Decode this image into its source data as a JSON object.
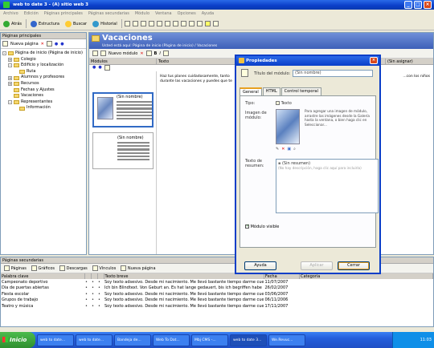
{
  "window": {
    "title": "web to date 3 - (A) sitio web 3"
  },
  "menu": [
    "Archivo",
    "Edición",
    "Páginas principales",
    "Páginas secundarias",
    "Módulo",
    "Ventana",
    "Opciones",
    "Ayuda"
  ],
  "toolbar": {
    "back": "Atrás",
    "structure": "Estructura",
    "search": "Buscar",
    "history": "Historial"
  },
  "left_panel": {
    "header": "Páginas principales",
    "new_page": "Nueva página",
    "tree": [
      {
        "label": "Página de inicio (Página de inicio)",
        "level": 0,
        "expander": "-"
      },
      {
        "label": "Colegio",
        "level": 1,
        "expander": "+"
      },
      {
        "label": "Edificio y localización",
        "level": 1,
        "expander": "-"
      },
      {
        "label": "Ruta",
        "level": 2,
        "expander": ""
      },
      {
        "label": "Alumnos y profesores",
        "level": 1,
        "expander": "+"
      },
      {
        "label": "Recursos",
        "level": 1,
        "expander": "+"
      },
      {
        "label": "Fechas y Ajustes",
        "level": 1,
        "expander": ""
      },
      {
        "label": "Vacaciones",
        "level": 1,
        "expander": ""
      },
      {
        "label": "Representantes",
        "level": 1,
        "expander": "-"
      },
      {
        "label": "Información",
        "level": 2,
        "expander": ""
      }
    ]
  },
  "main": {
    "title": "Vacaciones",
    "breadcrumb": "Usted está aquí: Página de inicio (Página de inicio) / Vacaciones",
    "new_module": "Nuevo módulo",
    "col_modules": "Módulos",
    "col_text": "Texto",
    "col_right": "(Sin asignar)",
    "module_names": [
      "(Sin nombre)",
      "(Sin nombre)"
    ],
    "content_text": "Haz tus planes cuidadosamente, tanto",
    "content_text2": "durante las vacaciones y puedes que te",
    "content_right": "...con los niños"
  },
  "dialog": {
    "title": "Propiedades",
    "module_title_label": "Título del módulo:",
    "module_title_value": "(Sin nombre)",
    "tabs": [
      "General",
      "HTML",
      "Control temporal"
    ],
    "type_label": "Tipo:",
    "type_value": "Texto",
    "image_label": "Imagen de módulo:",
    "image_hint": "Para agregar una imagen de módulo, arrastre las imágenes desde la Galería hasta la ventana, o bien haga clic en Seleccionar...",
    "text_label": "Texto de resumen:",
    "summary_title": "(Sin resumen)",
    "summary_hint": "(No hay descripción, haga clic aquí para incluirla)",
    "visible_label": "Módulo visible",
    "help_button": "Ayuda",
    "apply_button": "Aplicar",
    "close_button": "Cerrar"
  },
  "bottom_panel": {
    "header": "Páginas secundarias",
    "toolbar": [
      "Páginas",
      "Gráficos",
      "Descargas",
      "Vínculos",
      "Nueva página"
    ],
    "columns": [
      "Palabra clave",
      "",
      "",
      "",
      "Texto breve",
      "Fecha",
      "Categoría"
    ],
    "rows": [
      {
        "keyword": "Campeonato deportivo",
        "text": "Soy texto adsesivo. Desde mi nacimiento. Me llevó bastante tiempo darme cue",
        "date": "11/07/2007"
      },
      {
        "keyword": "Día de puertas abiertas",
        "text": "Ich bin Blindtext. Von Geburt an. Es hat lange gedauert, bis ich begriffen habe",
        "date": "26/02/2007"
      },
      {
        "keyword": "Fiesta escolar",
        "text": "Soy texto adsesivo. Desde mi nacimiento. Me llevó bastante tiempo darme cue",
        "date": "03/06/2007"
      },
      {
        "keyword": "Grupos de trabajo",
        "text": "Soy texto adsesivo. Desde mi nacimiento. Me llevó bastante tiempo darme cue",
        "date": "06/11/2006"
      },
      {
        "keyword": "Teatro y música",
        "text": "Soy texto adsesivo. Desde mi nacimiento. Me llevó bastante tiempo darme cue",
        "date": "17/11/2007"
      }
    ]
  },
  "taskbar": {
    "start": "Inicio",
    "tasks": [
      "web to date...",
      "web to date...",
      "Bandeja de...",
      "Web To Dat...",
      "Mbj CMS -...",
      "web to date 3...",
      "We.Revuc..."
    ],
    "clock": "11:03"
  }
}
